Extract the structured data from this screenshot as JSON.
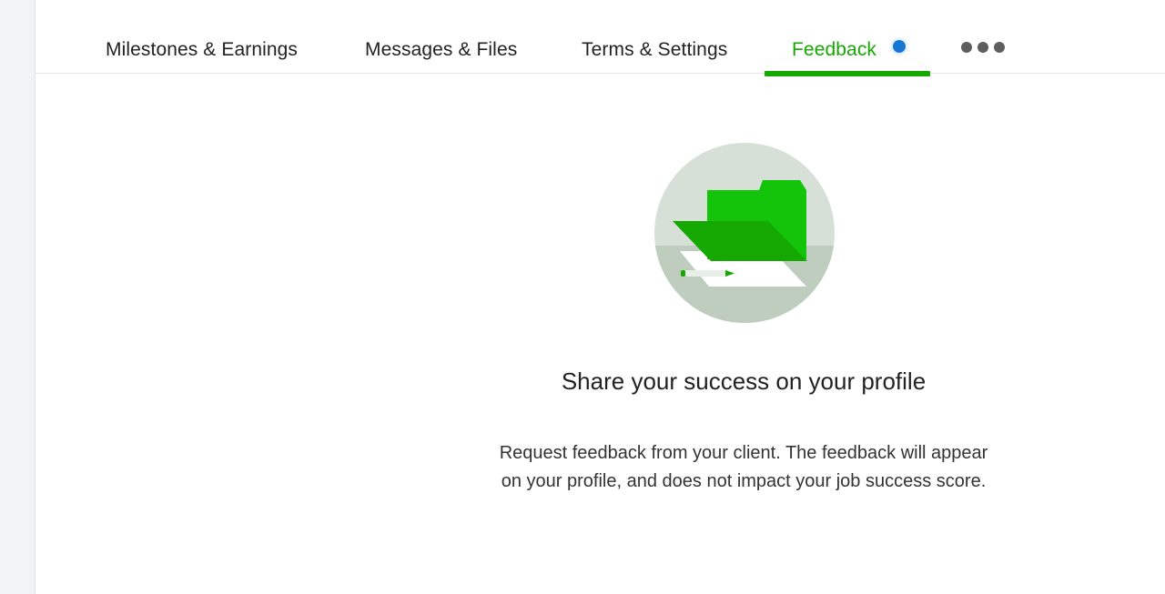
{
  "tabs": [
    {
      "label": "Milestones & Earnings",
      "active": false
    },
    {
      "label": "Messages & Files",
      "active": false
    },
    {
      "label": "Terms & Settings",
      "active": false
    },
    {
      "label": "Feedback",
      "active": true
    }
  ],
  "more_menu_icon": "ellipsis-icon",
  "notification_badge_icon": "blue-dot-icon",
  "illustration_icon": "folder-with-document-and-pencil-icon",
  "empty_state": {
    "title": "Share your success on your profile",
    "description": "Request feedback from your client. The feedback will appear on your profile, and does not impact your job success score."
  },
  "colors": {
    "accent_green": "#14a800",
    "notification_blue": "#1477d6",
    "text_primary": "#222222"
  }
}
